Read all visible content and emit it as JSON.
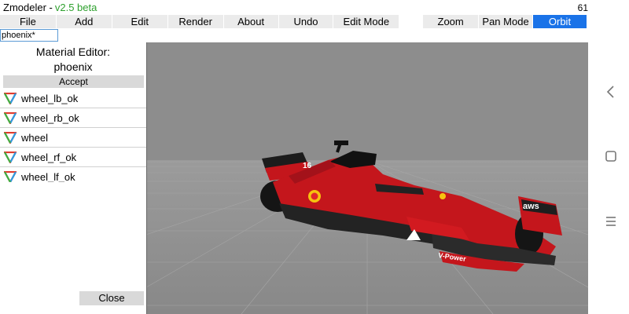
{
  "app": {
    "name": "Zmodeler -",
    "version": "v2.5 beta",
    "fps": "61"
  },
  "menu": {
    "items": [
      "File",
      "Add",
      "Edit",
      "Render",
      "About",
      "Undo",
      "Edit Mode",
      "Zoom",
      "Pan Mode",
      "Orbit"
    ],
    "active": "Orbit"
  },
  "name_field": {
    "value": "phoenix*"
  },
  "material_editor": {
    "title": "Material Editor:",
    "material_name": "phoenix",
    "accept_label": "Accept",
    "close_label": "Close",
    "items": [
      "wheel_lb_ok",
      "wheel_rb_ok",
      "wheel",
      "wheel_rf_ok",
      "wheel_lf_ok"
    ]
  },
  "viewport": {
    "car_texts": [
      "aws",
      "V-Power",
      "16"
    ]
  },
  "colors": {
    "accent": "#1a73e8",
    "version_green": "#2fa12f",
    "car_red": "#c4161c",
    "viewport_bg": "#8d8d8d"
  },
  "nav": {
    "icons": [
      "back-icon",
      "home-icon",
      "recents-icon"
    ]
  }
}
